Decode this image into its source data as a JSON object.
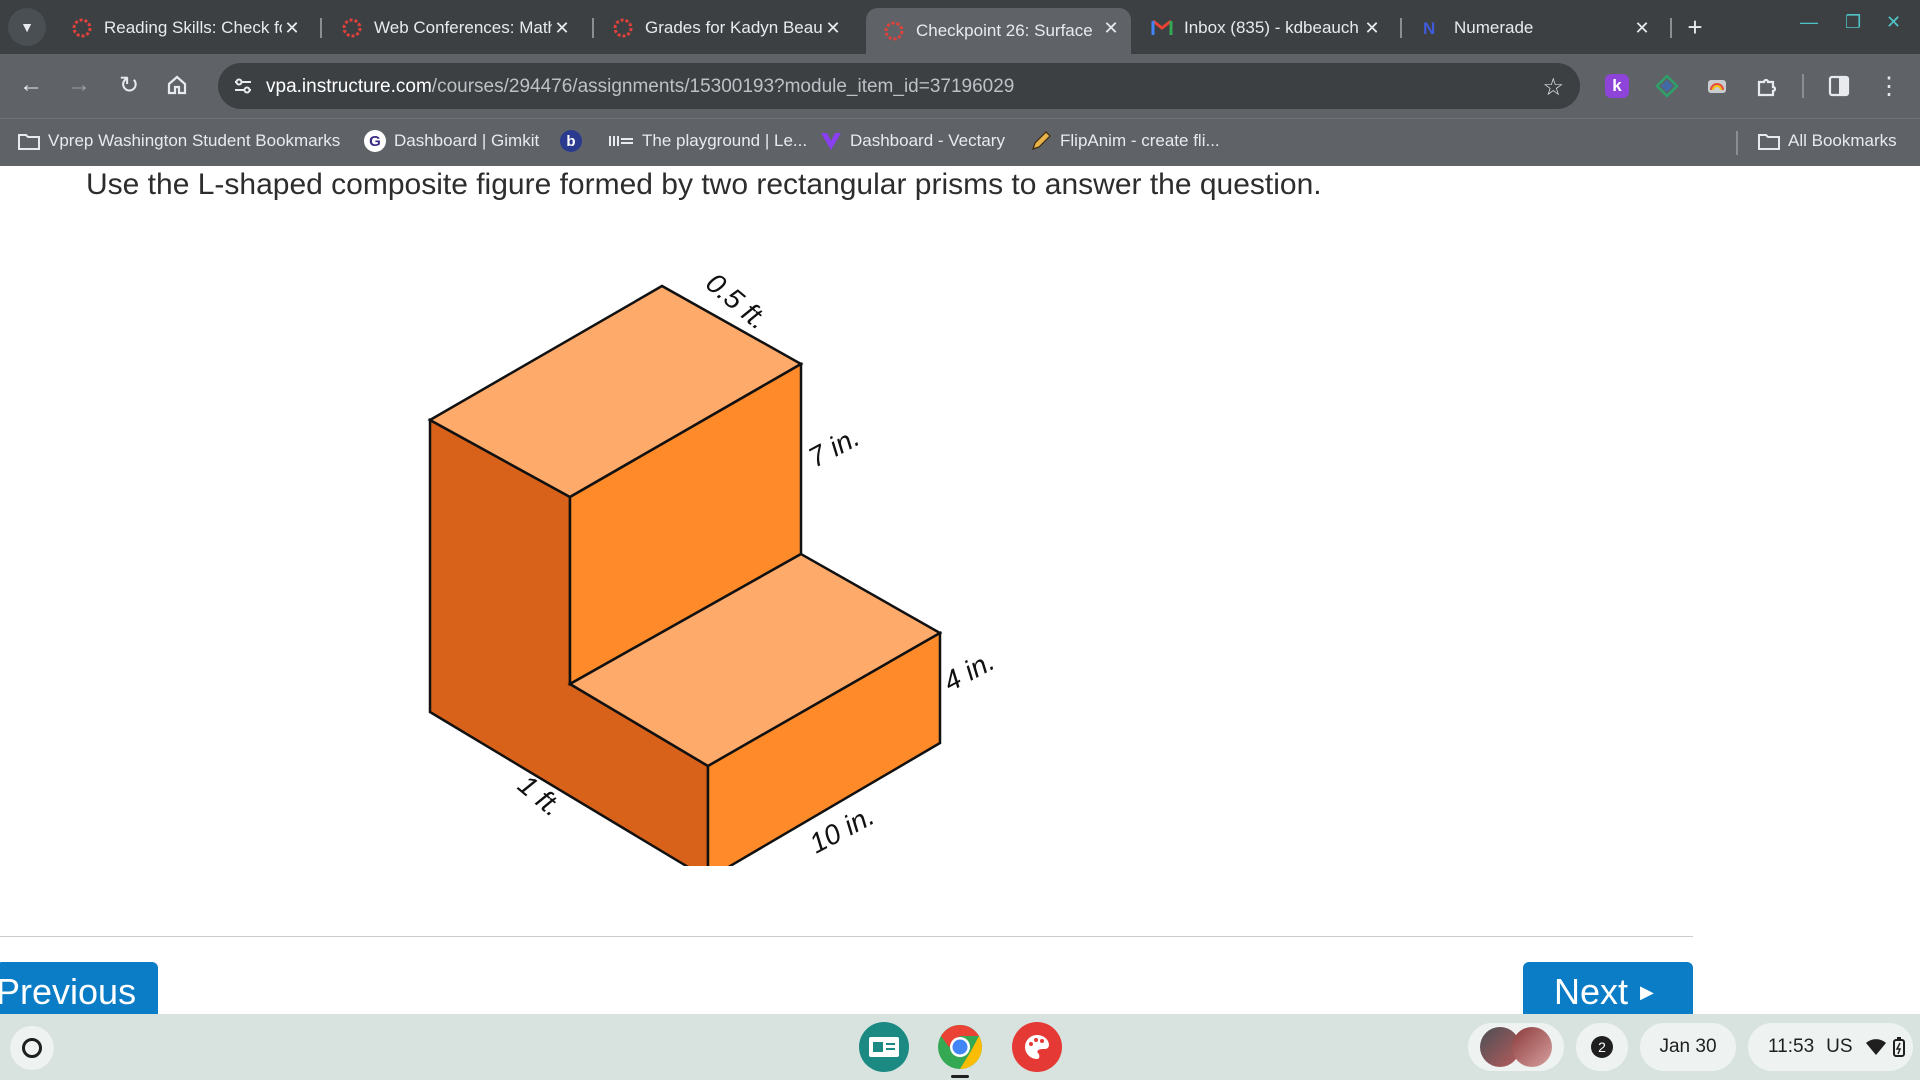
{
  "browser": {
    "tabs": [
      {
        "title": "Reading Skills: Check fo",
        "favicon": "canvas-icon",
        "active": false
      },
      {
        "title": "Web Conferences: Math",
        "favicon": "canvas-icon",
        "active": false
      },
      {
        "title": "Grades for Kadyn Beau",
        "favicon": "canvas-icon",
        "active": false
      },
      {
        "title": "Checkpoint 26: Surface",
        "favicon": "canvas-icon",
        "active": true
      },
      {
        "title": "Inbox (835) - kdbeauch",
        "favicon": "gmail-icon",
        "active": false
      },
      {
        "title": "Numerade",
        "favicon": "numerade-icon",
        "active": false
      }
    ],
    "url_host": "vpa.instructure.com",
    "url_path": "/courses/294476/assignments/15300193?module_item_id=37196029",
    "bookmarks": [
      {
        "label": "Vprep Washington Student Bookmarks",
        "icon": "folder-icon"
      },
      {
        "label": "Dashboard | Gimkit",
        "icon": "gimkit-icon"
      },
      {
        "label": "",
        "icon": "b-icon"
      },
      {
        "label": "The playground | Le...",
        "icon": "playground-icon"
      },
      {
        "label": "Dashboard - Vectary",
        "icon": "vectary-icon"
      },
      {
        "label": "FlipAnim - create fli...",
        "icon": "pencil-icon"
      }
    ],
    "all_bookmarks": "All Bookmarks",
    "extension_k": "k"
  },
  "content": {
    "question": "Use the L-shaped composite figure formed by two rectangular prisms to answer the question.",
    "figure_labels": {
      "top_depth": "0.5 ft.",
      "upper_height": "7 in.",
      "lower_height": "4 in.",
      "total_width": "1 ft.",
      "lower_depth": "10 in."
    },
    "previous_label": "Previous",
    "next_label": "Next"
  },
  "shelf": {
    "notification_count": "2",
    "date": "Jan 30",
    "time": "11:53",
    "locale": "US"
  },
  "colors": {
    "tabstrip": "#3c4043",
    "toolbar": "#5f6368",
    "button_blue": "#0b7dc6",
    "figure_top": "#fdaa6b",
    "figure_front": "#fe8a2a",
    "figure_left": "#d9621a"
  }
}
